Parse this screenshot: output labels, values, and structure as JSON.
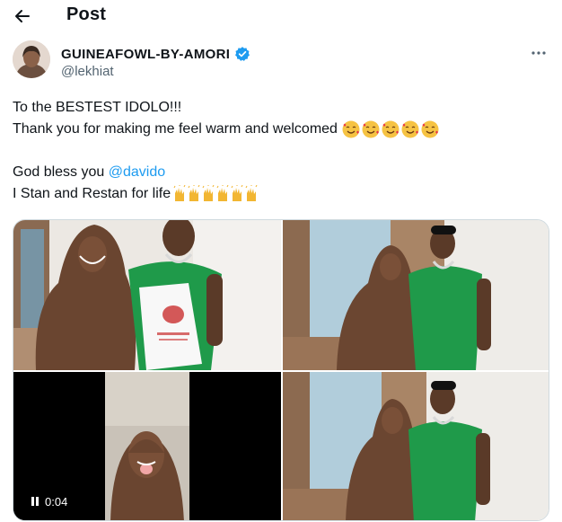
{
  "topbar": {
    "title": "Post"
  },
  "author": {
    "display_name": "GUINEAFOWL-BY-AMORI",
    "handle": "@lekhiat",
    "verified": true,
    "verified_color": "#1d9bf0"
  },
  "tweet": {
    "line1": "To the BESTEST IDOLO!!!",
    "line2": "Thank you for making me feel warm and welcomed",
    "line2_emoji": "smiling-face-with-hearts x5",
    "line3_prefix": "God bless you ",
    "line3_mention": "@davido",
    "line4": "I Stan and Restan for life",
    "line4_emoji": "raising-hands x6"
  },
  "media": {
    "items": [
      "photo",
      "photo",
      "video",
      "photo"
    ],
    "video_time": "0:04"
  },
  "colors": {
    "accent": "#1d9bf0",
    "text": "#0f1419",
    "secondary": "#536471"
  }
}
